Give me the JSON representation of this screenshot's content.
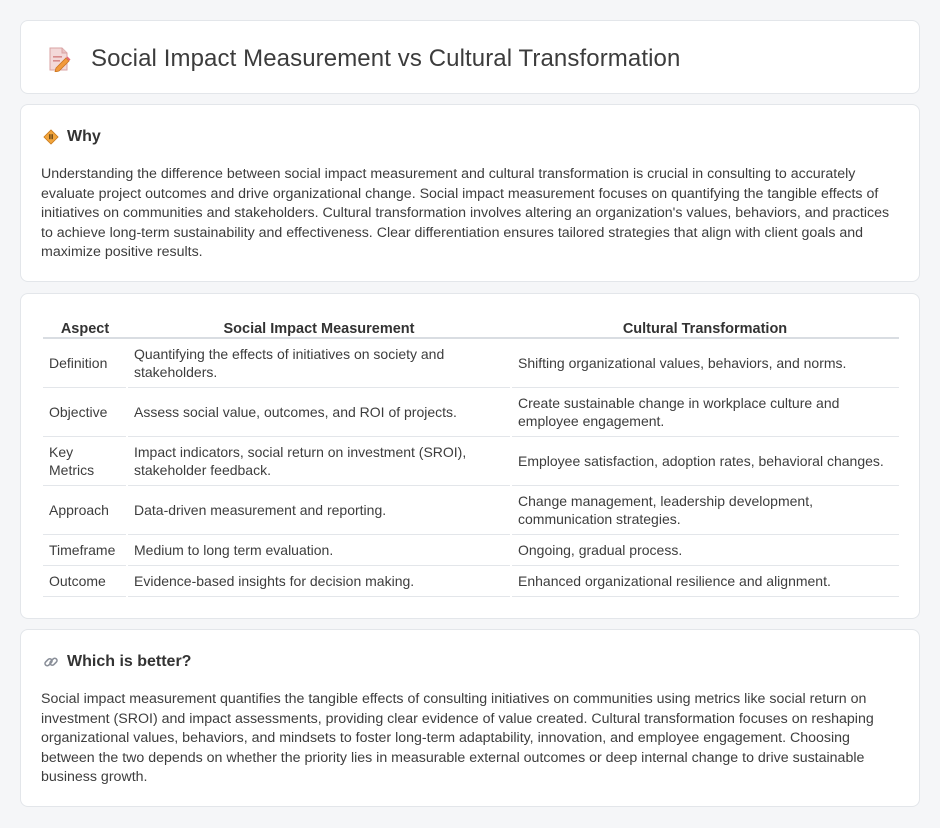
{
  "header": {
    "title": "Social Impact Measurement vs Cultural Transformation",
    "icon": "document-pencil-icon"
  },
  "why": {
    "heading": "Why",
    "icon": "diamond-sign-icon",
    "text": "Understanding the difference between social impact measurement and cultural transformation is crucial in consulting to accurately evaluate project outcomes and drive organizational change. Social impact measurement focuses on quantifying the tangible effects of initiatives on communities and stakeholders. Cultural transformation involves altering an organization's values, behaviors, and practices to achieve long-term sustainability and effectiveness. Clear differentiation ensures tailored strategies that align with client goals and maximize positive results."
  },
  "comparison": {
    "headers": [
      "Aspect",
      "Social Impact Measurement",
      "Cultural Transformation"
    ],
    "rows": [
      [
        "Definition",
        "Quantifying the effects of initiatives on society and stakeholders.",
        "Shifting organizational values, behaviors, and norms."
      ],
      [
        "Objective",
        "Assess social value, outcomes, and ROI of projects.",
        "Create sustainable change in workplace culture and employee engagement."
      ],
      [
        "Key Metrics",
        "Impact indicators, social return on investment (SROI), stakeholder feedback.",
        "Employee satisfaction, adoption rates, behavioral changes."
      ],
      [
        "Approach",
        "Data-driven measurement and reporting.",
        "Change management, leadership development, communication strategies."
      ],
      [
        "Timeframe",
        "Medium to long term evaluation.",
        "Ongoing, gradual process."
      ],
      [
        "Outcome",
        "Evidence-based insights for decision making.",
        "Enhanced organizational resilience and alignment."
      ]
    ]
  },
  "better": {
    "heading": "Which is better?",
    "icon": "link-icon",
    "text": "Social impact measurement quantifies the tangible effects of consulting initiatives on communities using metrics like social return on investment (SROI) and impact assessments, providing clear evidence of value created. Cultural transformation focuses on reshaping organizational values, behaviors, and mindsets to foster long-term adaptability, innovation, and employee engagement. Choosing between the two depends on whether the priority lies in measurable external outcomes or deep internal change to drive sustainable business growth."
  },
  "colors": {
    "background": "#f5f6f8",
    "card": "#ffffff",
    "border": "#e3e6ea",
    "icon_orange": "#f29a3c",
    "icon_pink": "#e46a74"
  }
}
